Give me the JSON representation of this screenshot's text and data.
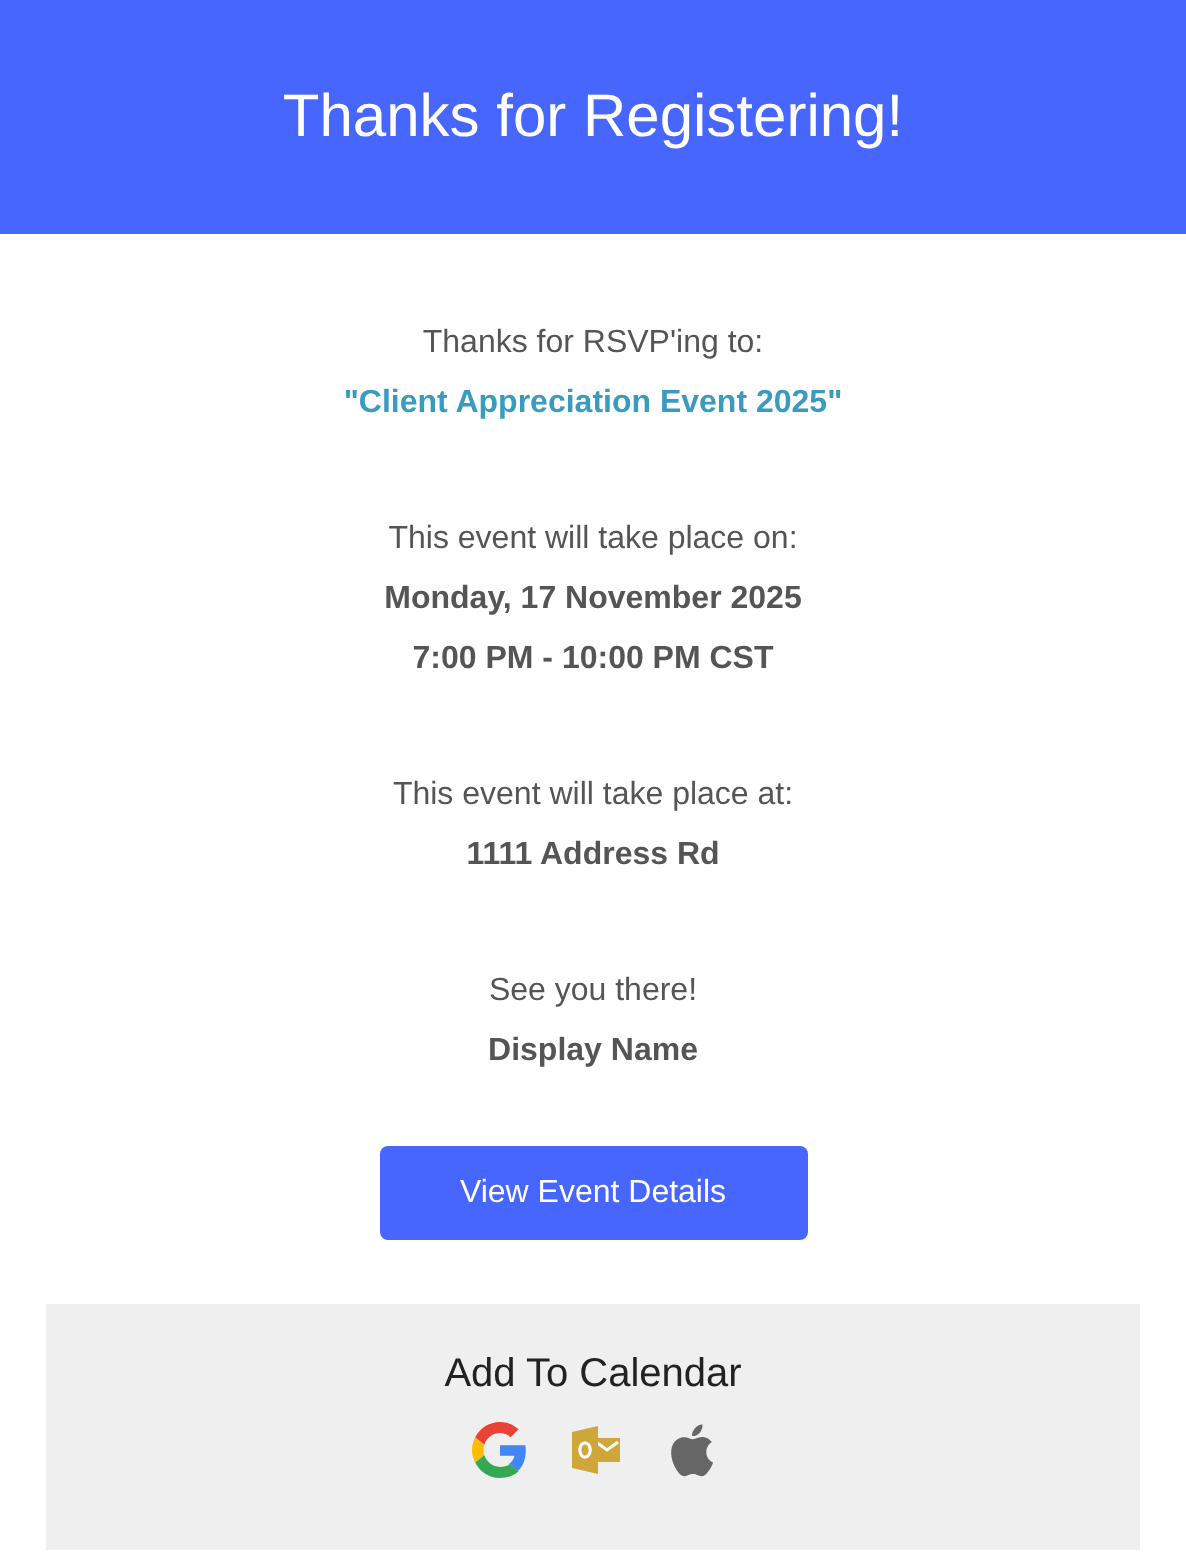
{
  "header": {
    "title": "Thanks for Registering!"
  },
  "sections": [
    {
      "lines": [
        {
          "kind": "plain",
          "text": "Thanks for RSVP'ing to:"
        },
        {
          "kind": "accent",
          "text": "\"Client Appreciation Event 2025\""
        }
      ]
    },
    {
      "lines": [
        {
          "kind": "plain",
          "text": "This event will take place on:"
        },
        {
          "kind": "bold",
          "text": "Monday, 17 November 2025"
        },
        {
          "kind": "bold",
          "text": "7:00 PM - 10:00 PM CST"
        }
      ]
    },
    {
      "lines": [
        {
          "kind": "plain",
          "text": "This event will take place at:"
        },
        {
          "kind": "bold",
          "text": "1111 Address Rd"
        }
      ]
    },
    {
      "lines": [
        {
          "kind": "plain",
          "text": "See you there!"
        },
        {
          "kind": "bold",
          "text": "Display Name"
        }
      ]
    }
  ],
  "button": {
    "label": "View Event Details"
  },
  "calendar": {
    "title": "Add To Calendar",
    "links": [
      {
        "kind": "google"
      },
      {
        "kind": "outlook"
      },
      {
        "kind": "apple"
      }
    ]
  }
}
